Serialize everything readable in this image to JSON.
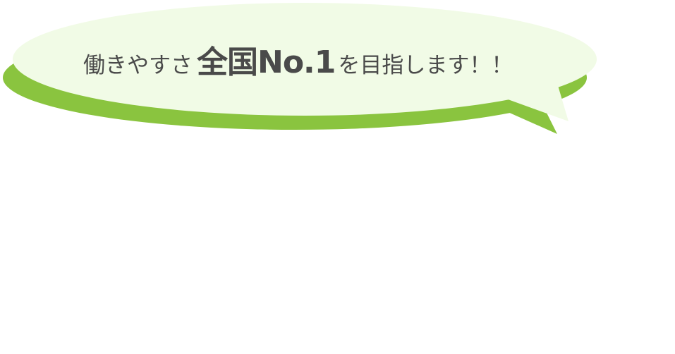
{
  "headline": {
    "lead": "働きやすさ",
    "emphasis": "全国No.1",
    "tail": "を目指します！！"
  },
  "colors": {
    "bubble_fill": "#f1fbe6",
    "bubble_shadow": "#8ac43f",
    "text": "#4a4a4a",
    "background": "#ffffff"
  },
  "icon": "speech-bubble"
}
